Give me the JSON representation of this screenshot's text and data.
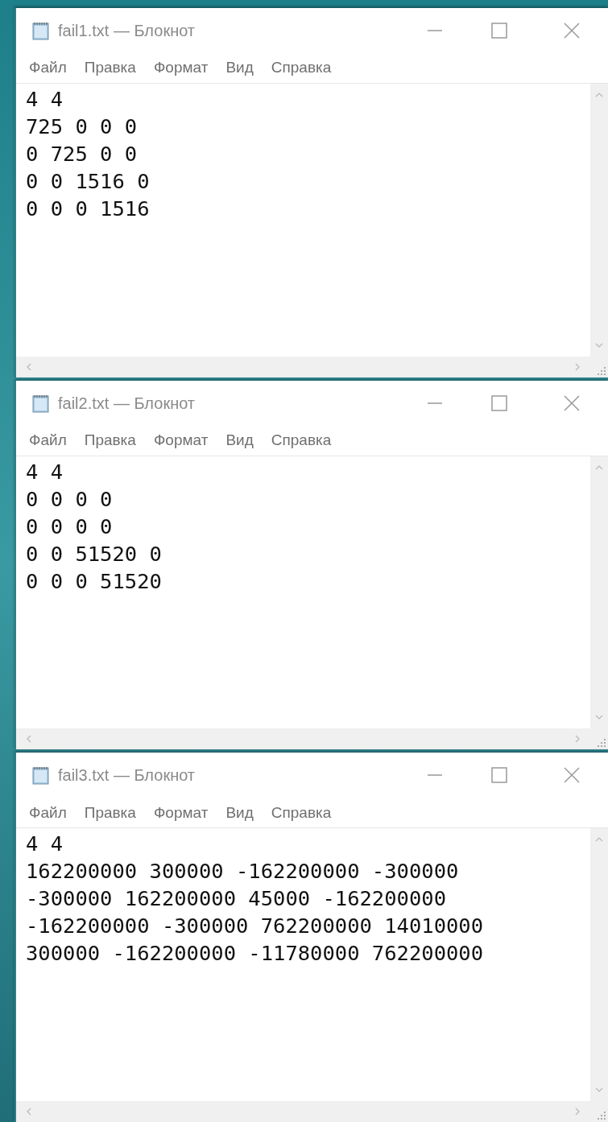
{
  "windows": [
    {
      "title": "fail1.txt — Блокнот",
      "menu": [
        "Файл",
        "Правка",
        "Формат",
        "Вид",
        "Справка"
      ],
      "lines": [
        "4 4",
        "725 0 0 0",
        "0 725 0 0",
        "0 0 1516 0",
        "0 0 0 1516"
      ]
    },
    {
      "title": "fail2.txt — Блокнот",
      "menu": [
        "Файл",
        "Правка",
        "Формат",
        "Вид",
        "Справка"
      ],
      "lines": [
        "4 4",
        "0 0 0 0",
        "0 0 0 0",
        "0 0 51520 0",
        "0 0 0 51520"
      ]
    },
    {
      "title": "fail3.txt — Блокнот",
      "menu": [
        "Файл",
        "Правка",
        "Формат",
        "Вид",
        "Справка"
      ],
      "lines": [
        "4 4",
        "162200000 300000 -162200000 -300000",
        "-300000 162200000 45000 -162200000",
        "-162200000 -300000 762200000 14010000",
        "300000 -162200000 -11780000 762200000"
      ]
    }
  ]
}
